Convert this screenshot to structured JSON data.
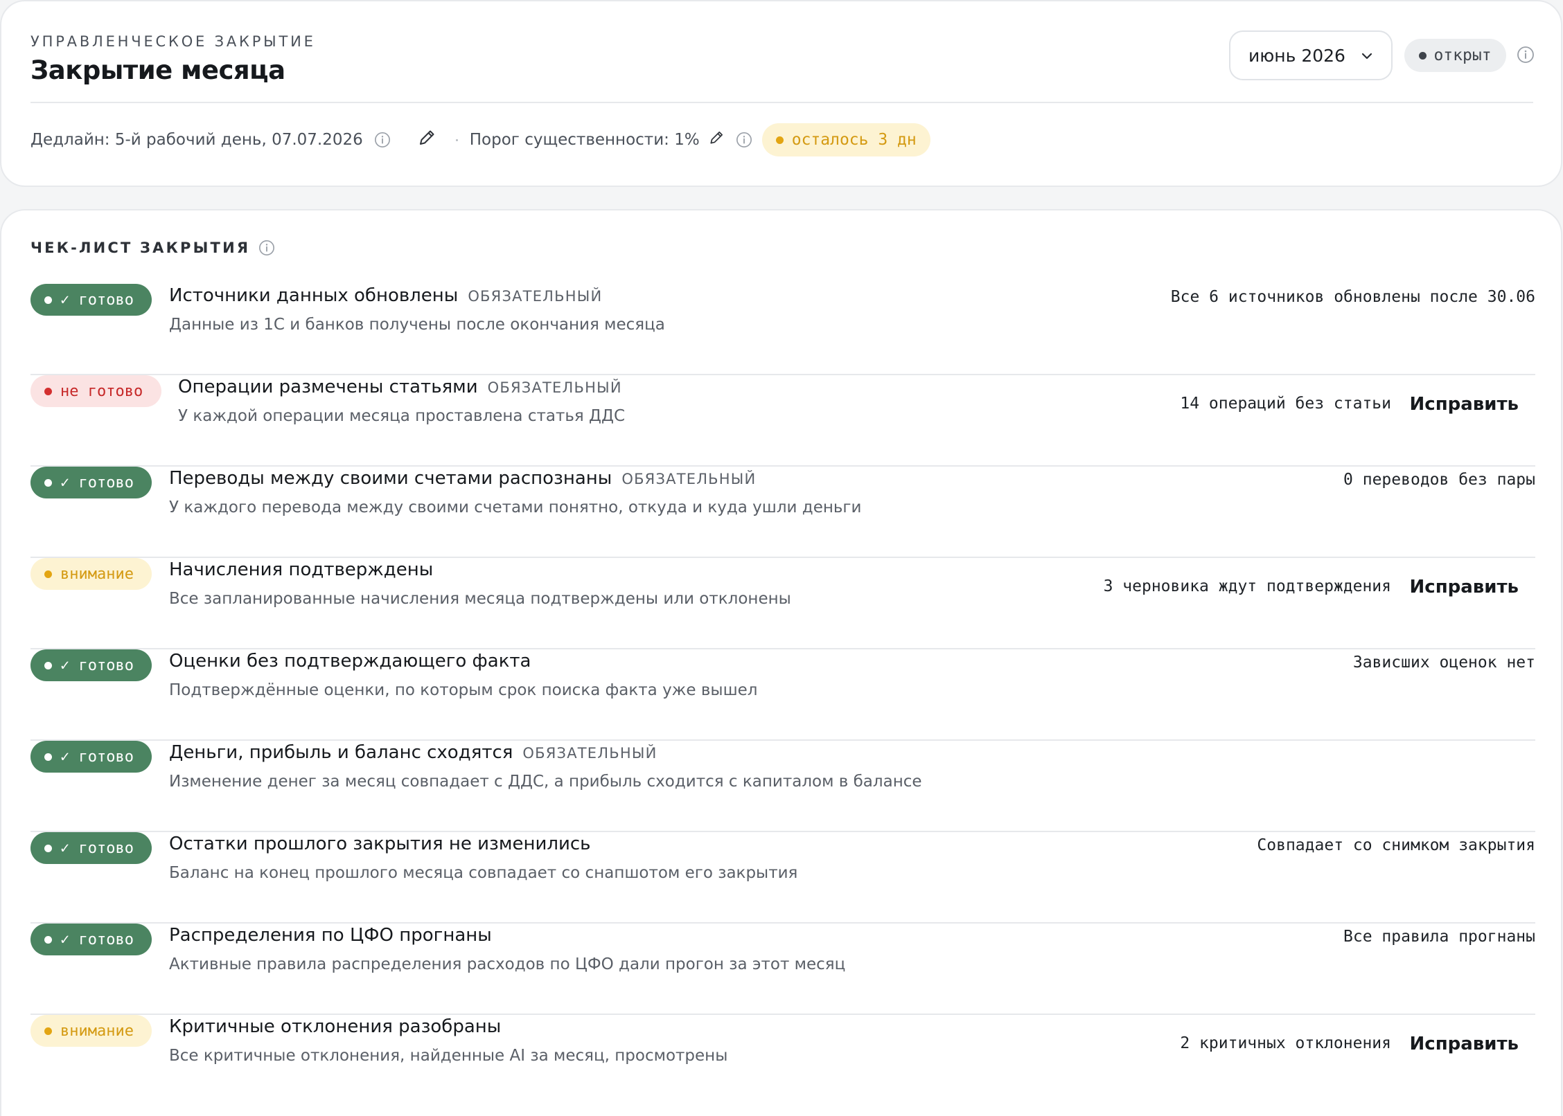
{
  "header": {
    "eyebrow": "УПРАВЛЕНЧЕСКОЕ ЗАКРЫТИЕ",
    "title": "Закрытие месяца",
    "period": "июнь 2026",
    "status": "открыт",
    "deadline": "Дедлайн: 5-й рабочий день, 07.07.2026",
    "materiality": "Порог существенности: 1%",
    "remaining": "осталось 3 дн"
  },
  "checklist": {
    "title": "ЧЕК-ЛИСТ ЗАКРЫТИЯ",
    "fix_label": "Исправить",
    "items": [
      {
        "badge": "✓ готово",
        "title": "Источники данных обновлены",
        "tag": "ОБЯЗАТЕЛЬНЫЙ",
        "desc": "Данные из 1С и банков получены после окончания месяца",
        "status": "Все 6 источников обновлены после 30.06"
      },
      {
        "badge": "не готово",
        "title": "Операции размечены статьями",
        "tag": "ОБЯЗАТЕЛЬНЫЙ",
        "desc": "У каждой операции месяца проставлена статья ДДС",
        "status": "14 операций без статьи"
      },
      {
        "badge": "✓ готово",
        "title": "Переводы между своими счетами распознаны",
        "tag": "ОБЯЗАТЕЛЬНЫЙ",
        "desc": "У каждого перевода между своими счетами понятно, откуда и куда ушли деньги",
        "status": "0 переводов без пары"
      },
      {
        "badge": "внимание",
        "title": "Начисления подтверждены",
        "tag": "",
        "desc": "Все запланированные начисления месяца подтверждены или отклонены",
        "status": "3 черновика ждут подтверждения"
      },
      {
        "badge": "✓ готово",
        "title": "Оценки без подтверждающего факта",
        "tag": "",
        "desc": "Подтверждённые оценки, по которым срок поиска факта уже вышел",
        "status": "Зависших оценок нет"
      },
      {
        "badge": "✓ готово",
        "title": "Деньги, прибыль и баланс сходятся",
        "tag": "ОБЯЗАТЕЛЬНЫЙ",
        "desc": "Изменение денег за месяц совпадает с ДДС, а прибыль сходится с капиталом в балансе",
        "status": ""
      },
      {
        "badge": "✓ готово",
        "title": "Остатки прошлого закрытия не изменились",
        "tag": "",
        "desc": "Баланс на конец прошлого месяца совпадает со снапшотом его закрытия",
        "status": "Совпадает со снимком закрытия"
      },
      {
        "badge": "✓ готово",
        "title": "Распределения по ЦФО прогнаны",
        "tag": "",
        "desc": "Активные правила распределения расходов по ЦФО дали прогон за этот месяц",
        "status": "Все правила прогнаны"
      },
      {
        "badge": "внимание",
        "title": "Критичные отклонения разобраны",
        "tag": "",
        "desc": "Все критичные отклонения, найденные AI за месяц, просмотрены",
        "status": "2 критичных отклонения"
      }
    ]
  },
  "colors": {
    "ok": "#4b8461",
    "bad_bg": "#fbe3e3",
    "bad_text": "#c62828",
    "warn_bg": "#fdf3d2",
    "warn_text": "#d49a12"
  },
  "icons": [
    "chevron-down-icon",
    "info-icon",
    "pencil-icon"
  ]
}
